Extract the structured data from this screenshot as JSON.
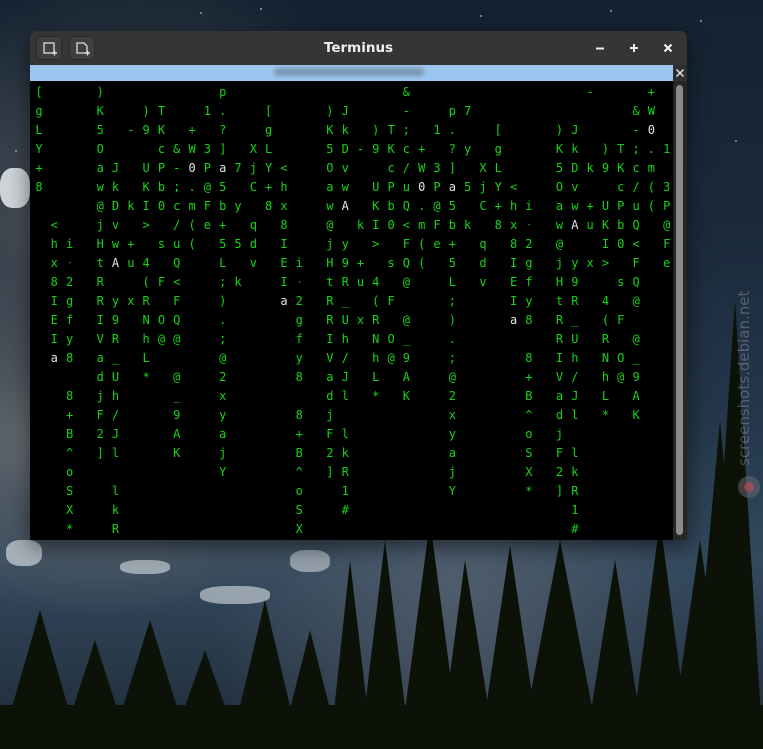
{
  "window": {
    "title": "Terminus",
    "new_tab_icon": "new-terminal-tab-icon",
    "split_icon": "split-terminal-icon",
    "minimize_symbol": "−",
    "maximize_symbol": "+",
    "close_symbol": "×",
    "tab_close_symbol": "×",
    "tab_color": "#9cc6ef"
  },
  "colors": {
    "matrix_green": "#17d317",
    "matrix_white": "#e4e4e4",
    "terminal_bg": "#000000"
  },
  "terminal": {
    "columns": [
      {
        "c": "[gLY+8    ",
        "w": [
          7
        ]
      },
      {
        "c": "    <hx8IEIa",
        "w": [
          11
        ]
      },
      {
        "c": "      iᐧ2gfy8 8+B^oSX*",
        "w": []
      },
      {
        "c": "    ",
        "w": []
      },
      {
        "c": ")K5Oaw@jHtRRIVadjF2]",
        "w": []
      },
      {
        "c": " JkDvwA y9R_Uh/Jl lkR1#",
        "w": [
          6,
          7
        ]
      },
      {
        "c": "-   k +u x    ",
        "w": []
      },
      {
        "c": ")9 UKI> 4(RNhL*",
        "w": []
      },
      {
        "c": " TKcPb0 s F O@ ",
        "w": []
      },
      {
        "c": "&-;c/uQ<FQ@ @_9AK",
        "w": []
      },
      {
        "c": "+W0.m(( ",
        "w": [
          2
        ]
      },
      {
        "c": "1 3P@Fe ",
        "w": []
      },
      {
        "c": "p.?]a5b+5L;).;@2xyajY",
        "w": [
          4
        ]
      },
      {
        "c": " 7 y 5 k ",
        "w": []
      },
      {
        "c": " XjC qdv",
        "w": []
      }
    ]
  }
}
